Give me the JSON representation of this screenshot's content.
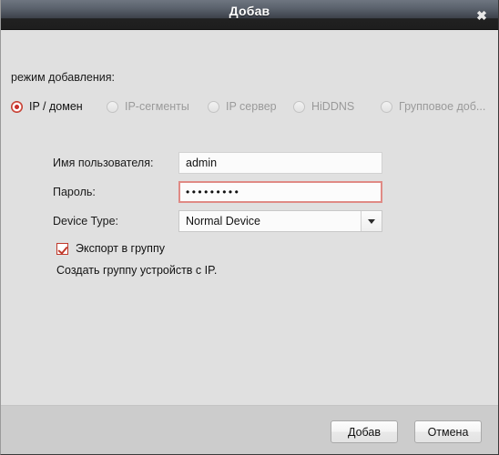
{
  "titlebar": {
    "title": "Добав",
    "close_icon": "close-icon",
    "close_glyph": "✖"
  },
  "body": {
    "mode_label": "режим добавления:",
    "modes": [
      {
        "label": "IP / домен",
        "selected": true,
        "disabled": false
      },
      {
        "label": "IP-сегменты",
        "selected": false,
        "disabled": true
      },
      {
        "label": "IP сервер",
        "selected": false,
        "disabled": true
      },
      {
        "label": "HiDDNS",
        "selected": false,
        "disabled": true
      },
      {
        "label": "Групповое доб...",
        "selected": false,
        "disabled": true
      }
    ],
    "fields": {
      "username_label": "Имя пользователя:",
      "username_value": "admin",
      "password_label": "Пароль:",
      "password_value": "•••••••••",
      "device_type_label": "Device Type:",
      "device_type_value": "Normal Device",
      "device_type_arrow_icon": "chevron-down-icon"
    },
    "export_checkbox": {
      "label": "Экспорт в группу",
      "checked": true
    },
    "hint": "Создать группу устройств с IP."
  },
  "footer": {
    "ok_label": "Добав",
    "cancel_label": "Отмена"
  },
  "colors": {
    "accent_red": "#c0392b",
    "error_border": "#e08a85",
    "titlebar_dark": "#1e1e1e",
    "body_bg": "#e0e0e0",
    "footer_bg": "#cccccc"
  }
}
